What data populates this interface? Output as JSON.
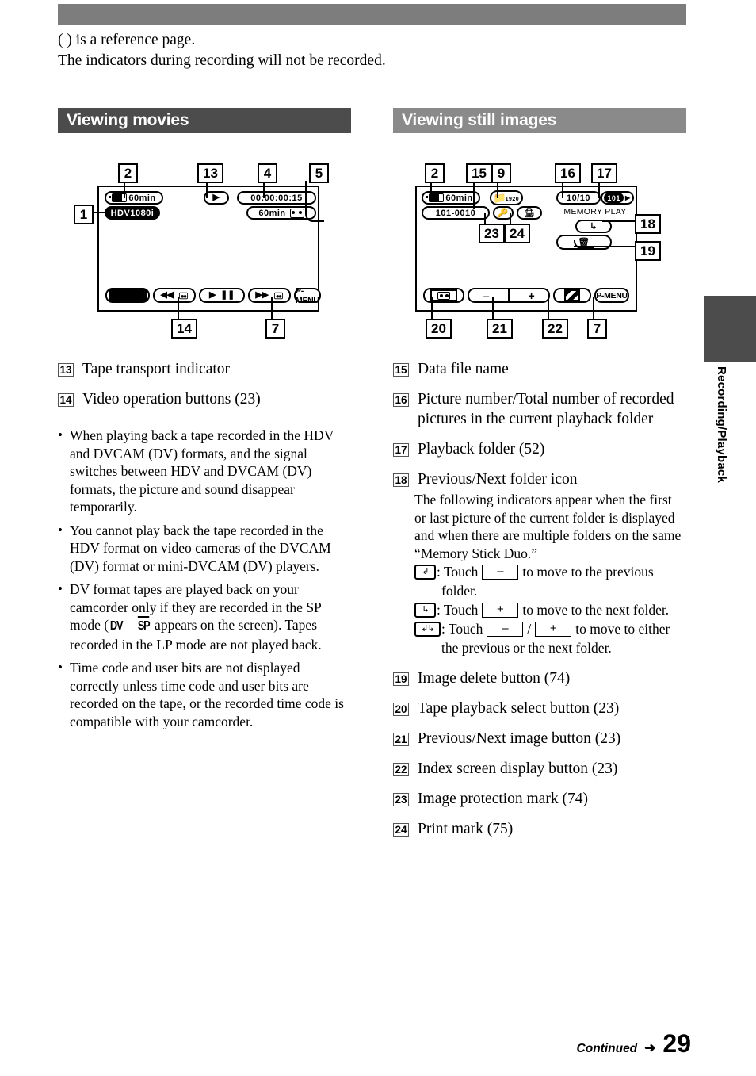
{
  "intro": {
    "line1": "( ) is a reference page.",
    "line2": "The indicators during recording will not be recorded."
  },
  "sections": {
    "movies": {
      "title": "Viewing movies",
      "bar_color": "#4c4c4c"
    },
    "stills": {
      "title": "Viewing still images",
      "bar_color": "#8a8a8a"
    }
  },
  "movies_screen": {
    "callouts": {
      "c1": "1",
      "c2": "2",
      "c13": "13",
      "c4": "4",
      "c5": "5",
      "c14": "14",
      "c7": "7"
    },
    "battery_time": "60min",
    "format_badge": "HDV1080i",
    "transport_glyph": "play",
    "timecode": "00:00:00:15",
    "tape_remain": "60min",
    "buttons": {
      "stop": "stop",
      "rewind": "rewind",
      "play": "play",
      "pause": "pause",
      "forward": "forward",
      "pmenu": "P-MENU"
    }
  },
  "stills_screen": {
    "callouts": {
      "c2": "2",
      "c15": "15",
      "c9": "9",
      "c16": "16",
      "c17": "17",
      "c18": "18",
      "c19": "19",
      "c23": "23",
      "c24": "24",
      "c20": "20",
      "c21": "21",
      "c22": "22",
      "c7": "7"
    },
    "battery_time": "60min",
    "data_file_name": "101-0010",
    "quality_icon_label": "1920",
    "picture_count": "10/10",
    "folder_number": "101",
    "memory_play": "MEMORY PLAY",
    "folder_nav_icon": "next-folder-icon",
    "delete_icon": "trash-icon",
    "buttons": {
      "tape_select": "cassette",
      "minus": "–",
      "plus": "+",
      "index": "index",
      "pmenu": "P-MENU"
    }
  },
  "left_column": {
    "items": [
      {
        "num": "13",
        "text": "Tape transport indicator"
      },
      {
        "num": "14",
        "text": "Video operation buttons (23)"
      }
    ],
    "bullets": [
      {
        "text": "When playing back a tape recorded in the HDV and DVCAM (DV) formats, and the signal switches between HDV and DVCAM (DV) formats, the picture and sound disappear temporarily."
      },
      {
        "text": "You cannot play back the tape recorded in the HDV format on video cameras of the DVCAM (DV) format or mini-DVCAM (DV) players."
      }
    ],
    "bullet_dv": {
      "part1": "DV format tapes are played back on your camcorder only if they are recorded in the SP mode (",
      "logo_dv": "DV",
      "logo_sp": "SP",
      "part2": " appears on the screen). Tapes recorded in the LP mode are not played back."
    },
    "bullet_last": "Time code and user bits are not displayed correctly unless time code and user bits are recorded on the tape, or the recorded time code is compatible with your camcorder."
  },
  "right_column": {
    "items": [
      {
        "num": "15",
        "text": "Data file name"
      },
      {
        "num": "16",
        "text": "Picture number/Total number of recorded pictures in the current playback folder"
      },
      {
        "num": "17",
        "text": "Playback folder (52)"
      },
      {
        "num": "18",
        "text": "Previous/Next folder icon"
      }
    ],
    "folder_note": "The following indicators appear when the first or last picture of the current folder is displayed and when there are multiple folders on the same “Memory Stick Duo.”",
    "touch_lines": [
      {
        "icon": "previous-folder-icon",
        "pre": ": Touch",
        "key1": "–",
        "key2": null,
        "post": "to move to the previous",
        "cont": "folder."
      },
      {
        "icon": "next-folder-icon",
        "pre": ": Touch",
        "key1": "+",
        "key2": null,
        "post": "to move to the next folder.",
        "cont": null
      },
      {
        "icon": "previous-next-folder-icon",
        "pre": ": Touch",
        "key1": "–",
        "key2": "+",
        "post": "to move to either",
        "cont": "the previous or the next folder."
      }
    ],
    "items2": [
      {
        "num": "19",
        "text": "Image delete button (74)"
      },
      {
        "num": "20",
        "text": "Tape playback select button (23)"
      },
      {
        "num": "21",
        "text": "Previous/Next image button (23)"
      },
      {
        "num": "22",
        "text": "Index screen display button (23)"
      },
      {
        "num": "23",
        "text": "Image protection mark (74)"
      },
      {
        "num": "24",
        "text": "Print mark (75)"
      }
    ]
  },
  "side_tab": {
    "label": "Recording/Playback",
    "color": "#4c4c4c"
  },
  "footer": {
    "continued": "Continued",
    "arrow": "➜",
    "page": "29"
  }
}
